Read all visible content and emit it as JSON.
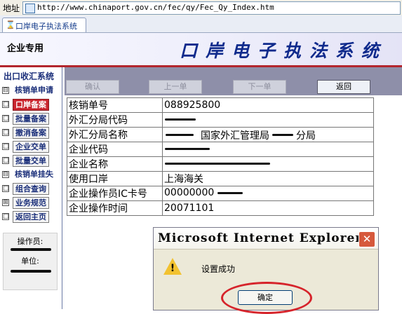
{
  "address_bar": {
    "label": "地址",
    "url": "http://www.chinaport.gov.cn/fec/qy/Fec_Qy_Index.htm"
  },
  "tab": {
    "label": "口岸电子执法系统"
  },
  "banner": {
    "left_label": "企业专用",
    "title": "口岸电子执法系统"
  },
  "sidebar": {
    "title": "出口收汇系统",
    "items": [
      {
        "label": "核销单申请",
        "prefix": "⊟"
      },
      {
        "label": "口岸备案",
        "prefix": "□"
      },
      {
        "label": "批量备案",
        "prefix": "□"
      },
      {
        "label": "撤消备案",
        "prefix": "□"
      },
      {
        "label": "企业交单",
        "prefix": "□"
      },
      {
        "label": "批量交单",
        "prefix": "□"
      },
      {
        "label": "核销单挂失",
        "prefix": "⊟"
      },
      {
        "label": "组合查询",
        "prefix": "□"
      },
      {
        "label": "业务规范",
        "prefix": "⊞"
      },
      {
        "label": "返回主页",
        "prefix": "□"
      }
    ],
    "operator_label": "操作员:",
    "unit_label": "单位:"
  },
  "toolbar": {
    "confirm": "确认",
    "prev": "上一单",
    "next": "下一单",
    "back": "返回"
  },
  "record": {
    "rows": [
      {
        "key": "核销单号",
        "value": "088925800"
      },
      {
        "key": "外汇分局代码",
        "value": ""
      },
      {
        "key": "外汇分局名称",
        "value": "国家外汇管理局",
        "value2": "分局"
      },
      {
        "key": "企业代码",
        "value": ""
      },
      {
        "key": "企业名称",
        "value": ""
      },
      {
        "key": "使用口岸",
        "value": "上海海关"
      },
      {
        "key": "企业操作员IC卡号",
        "value": "00000000"
      },
      {
        "key": "企业操作时间",
        "value": "20071101"
      }
    ]
  },
  "dialog": {
    "title": "Microsoft Internet Explorer",
    "message": "设置成功",
    "ok_label": "确定",
    "close_glyph": "✕",
    "warning_glyph": "!"
  },
  "colors": {
    "accent_red": "#c9252e",
    "banner_title": "#0f2a8c",
    "toolbar_bg": "#8e8fa9",
    "annotation_red": "#d6242b"
  }
}
